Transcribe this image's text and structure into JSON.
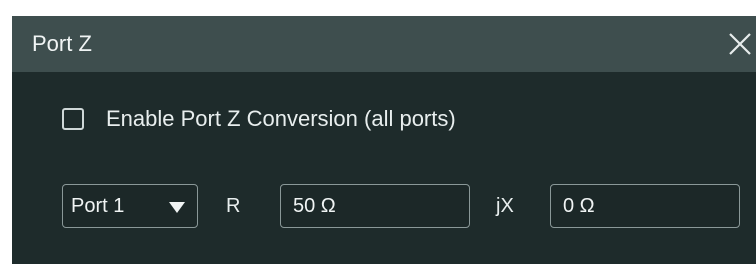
{
  "dialog": {
    "title": "Port Z",
    "close_icon": "close-icon"
  },
  "enable": {
    "label": "Enable Port Z Conversion (all ports)",
    "checked": false
  },
  "port_select": {
    "value": "Port 1",
    "icon": "chevron-down-icon"
  },
  "resistance": {
    "label": "R",
    "value": "50 Ω"
  },
  "reactance": {
    "label": "jX",
    "value": "0 Ω"
  },
  "colors": {
    "titlebar": "#3e4e4e",
    "body": "#1e2b2b",
    "text": "#e6ecec",
    "field_border": "#8a9898"
  }
}
